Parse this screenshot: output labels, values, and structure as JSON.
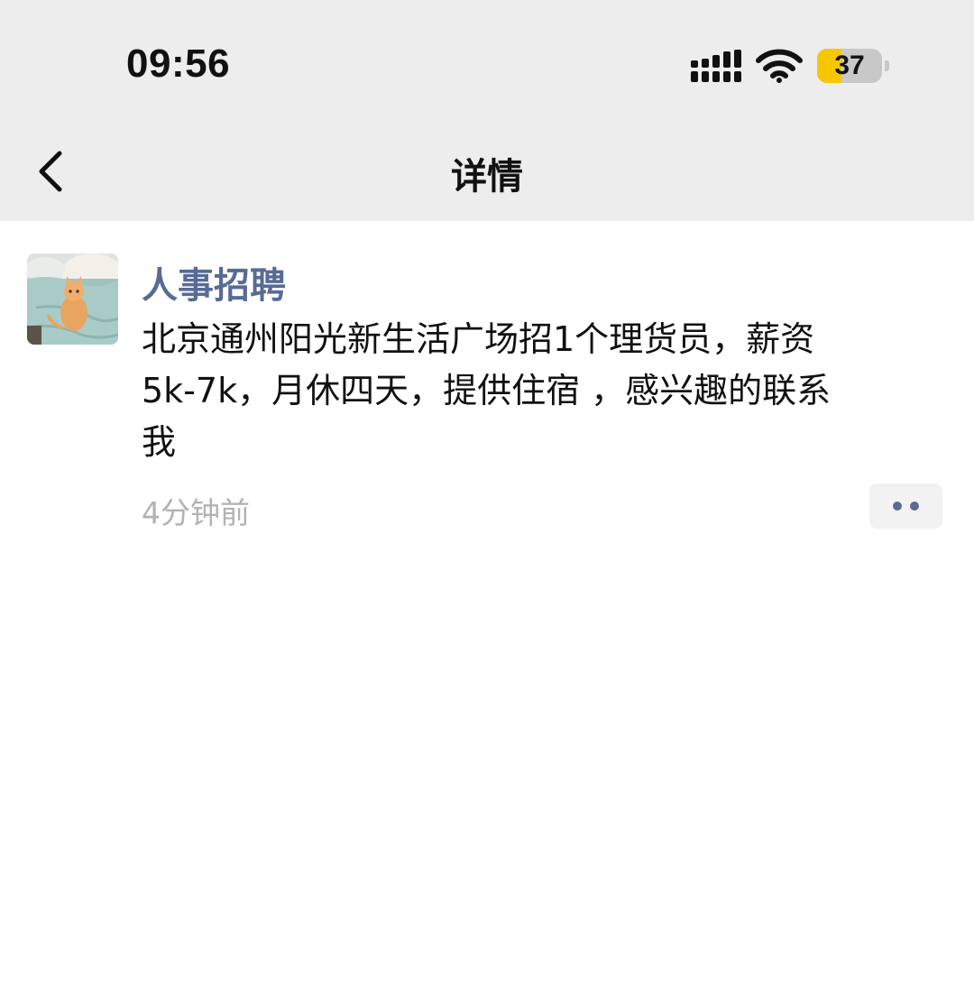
{
  "status_bar": {
    "time": "09:56",
    "battery_level": "37",
    "battery_fraction": 0.37,
    "icons": [
      "signal-icon",
      "wifi-icon",
      "battery-icon"
    ]
  },
  "nav": {
    "back_icon": "chevron-left-icon",
    "title": "详情"
  },
  "post": {
    "avatar_icon": "cat-avatar-image",
    "author": "人事招聘",
    "body_lines": [
      "北京通州阳光新生活广场招1个理货员，薪资",
      "5k-7k，月休四天，提供住宿 ，感兴趣的联系",
      "我"
    ],
    "time": "4分钟前",
    "more_icon": "more-dots-icon"
  },
  "colors": {
    "top_background": "#ededed",
    "author_link": "#576b95",
    "timestamp": "#b2b2b2",
    "battery_accent": "#f6c600"
  }
}
